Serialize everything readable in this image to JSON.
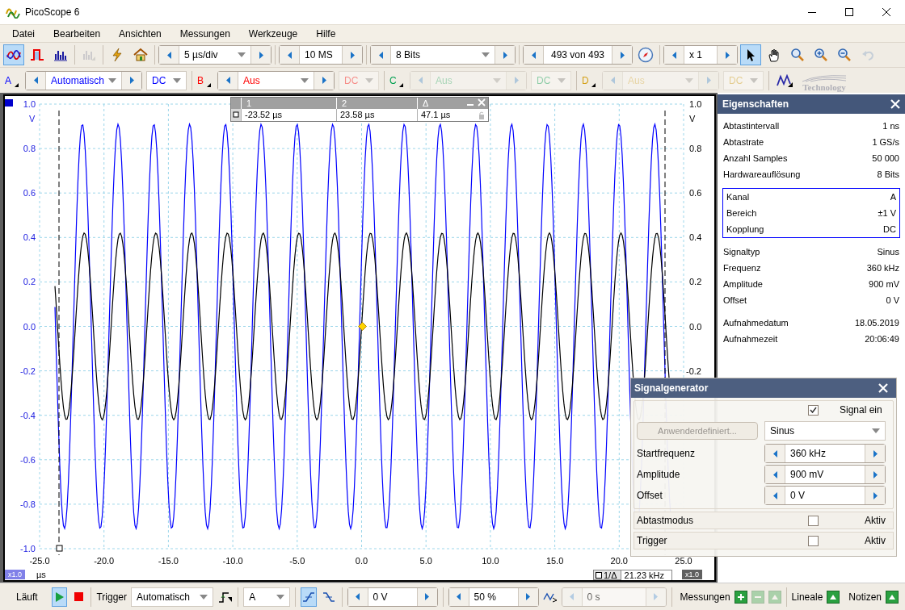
{
  "window": {
    "title": "PicoScope 6"
  },
  "menu": [
    "Datei",
    "Bearbeiten",
    "Ansichten",
    "Messungen",
    "Werkzeuge",
    "Hilfe"
  ],
  "modes": [
    {
      "kind": "scope",
      "selected": true,
      "disabled": false
    },
    {
      "kind": "persistence",
      "selected": false,
      "disabled": false
    },
    {
      "kind": "spectrum",
      "selected": false,
      "disabled": false
    },
    {
      "kind": "xy",
      "selected": false,
      "disabled": true
    },
    {
      "kind": "generator",
      "selected": false,
      "disabled": false
    },
    {
      "kind": "home",
      "selected": false,
      "disabled": false
    }
  ],
  "timebase": "5 µs/div",
  "samples": "10 MS",
  "resolution": "8 Bits",
  "buffer": "493 von 493",
  "zoom": "x 1",
  "tools": [
    {
      "kind": "pointer",
      "selected": true,
      "disabled": false
    },
    {
      "kind": "hand",
      "selected": false,
      "disabled": false
    },
    {
      "kind": "zoom-fit",
      "selected": false,
      "disabled": false
    },
    {
      "kind": "zoom-in",
      "selected": false,
      "disabled": false
    },
    {
      "kind": "zoom-out",
      "selected": false,
      "disabled": false
    },
    {
      "kind": "undo",
      "selected": false,
      "disabled": true
    }
  ],
  "channels": [
    {
      "label": "A",
      "range": "Automatisch",
      "coupling": "DC",
      "color": "#0000ff",
      "enabled": true,
      "available": true
    },
    {
      "label": "B",
      "range": "Aus",
      "coupling": "DC",
      "color": "#ff0000",
      "enabled": false,
      "available": true
    },
    {
      "label": "C",
      "range": "Aus",
      "coupling": "DC",
      "color": "#00a050",
      "enabled": false,
      "available": false
    },
    {
      "label": "D",
      "range": "Aus",
      "coupling": "DC",
      "color": "#d4a017",
      "enabled": false,
      "available": false
    }
  ],
  "logo": "Technology",
  "plot": {
    "left_ticks": [
      "1.0",
      "0.8",
      "0.6",
      "0.4",
      "0.2",
      "0.0",
      "-0.2",
      "-0.4",
      "-0.6",
      "-0.8",
      "-1.0"
    ],
    "left_unit": "V",
    "right_ticks": [
      "1.0",
      "0.8",
      "0.6",
      "0.4",
      "0.2",
      "0.0",
      "-0.2"
    ],
    "right_unit": "V",
    "x_ticks": [
      "-25.0",
      "-20.0",
      "-15.0",
      "-10.0",
      "-5.0",
      "0.0",
      "5.0",
      "10.0",
      "15.0",
      "20.0",
      "25.0"
    ],
    "x_unit": "µs",
    "x_scale": "x1.0",
    "right_scale": "x1.0",
    "freq_label": "1/Δ",
    "freq_value": "21.23 kHz"
  },
  "rulers": {
    "headers": [
      "1",
      "2",
      "Δ"
    ],
    "values": [
      "-23.52 µs",
      "23.58 µs",
      "47.1 µs"
    ]
  },
  "properties": {
    "title": "Eigenschaften",
    "groups": [
      {
        "boxed": false,
        "rows": [
          [
            "Abtastintervall",
            "1 ns"
          ],
          [
            "Abtastrate",
            "1 GS/s"
          ],
          [
            "Anzahl Samples",
            "50 000"
          ],
          [
            "Hardwareauflösung",
            "8 Bits"
          ]
        ]
      },
      {
        "boxed": true,
        "rows": [
          [
            "Kanal",
            "A"
          ],
          [
            "Bereich",
            "±1 V"
          ],
          [
            "Kopplung",
            "DC"
          ]
        ]
      },
      {
        "boxed": false,
        "rows": [
          [
            "Signaltyp",
            "Sinus"
          ],
          [
            "Frequenz",
            "360 kHz"
          ],
          [
            "Amplitude",
            "900 mV"
          ],
          [
            "Offset",
            "0 V"
          ]
        ]
      },
      {
        "boxed": false,
        "rows": [
          [
            "Aufnahmedatum",
            "18.05.2019"
          ],
          [
            "Aufnahmezeit",
            "20:06:49"
          ]
        ]
      }
    ]
  },
  "generator": {
    "title": "Signalgenerator",
    "signal_label": "Signal ein",
    "signal_on": true,
    "custom_button": "Anwenderdefiniert...",
    "custom_disabled": true,
    "waveform": "Sinus",
    "fields": [
      {
        "label": "Startfrequenz",
        "value": "360 kHz"
      },
      {
        "label": "Amplitude",
        "value": "900 mV"
      },
      {
        "label": "Offset",
        "value": "0 V"
      }
    ],
    "sections": [
      {
        "label": "Abtastmodus",
        "check_label": "Aktiv",
        "checked": false
      },
      {
        "label": "Trigger",
        "check_label": "Aktiv",
        "checked": false
      }
    ]
  },
  "status": {
    "run_label": "Läuft",
    "running": true,
    "trigger_label": "Trigger",
    "trigger_mode": "Automatisch",
    "trigger_source": "A",
    "rising": true,
    "threshold": "0 V",
    "pretrigger": "50 %",
    "delay": "0 s",
    "delay_disabled": true,
    "measurements": "Messungen",
    "rulers": "Lineale",
    "notes": "Notizen"
  }
}
